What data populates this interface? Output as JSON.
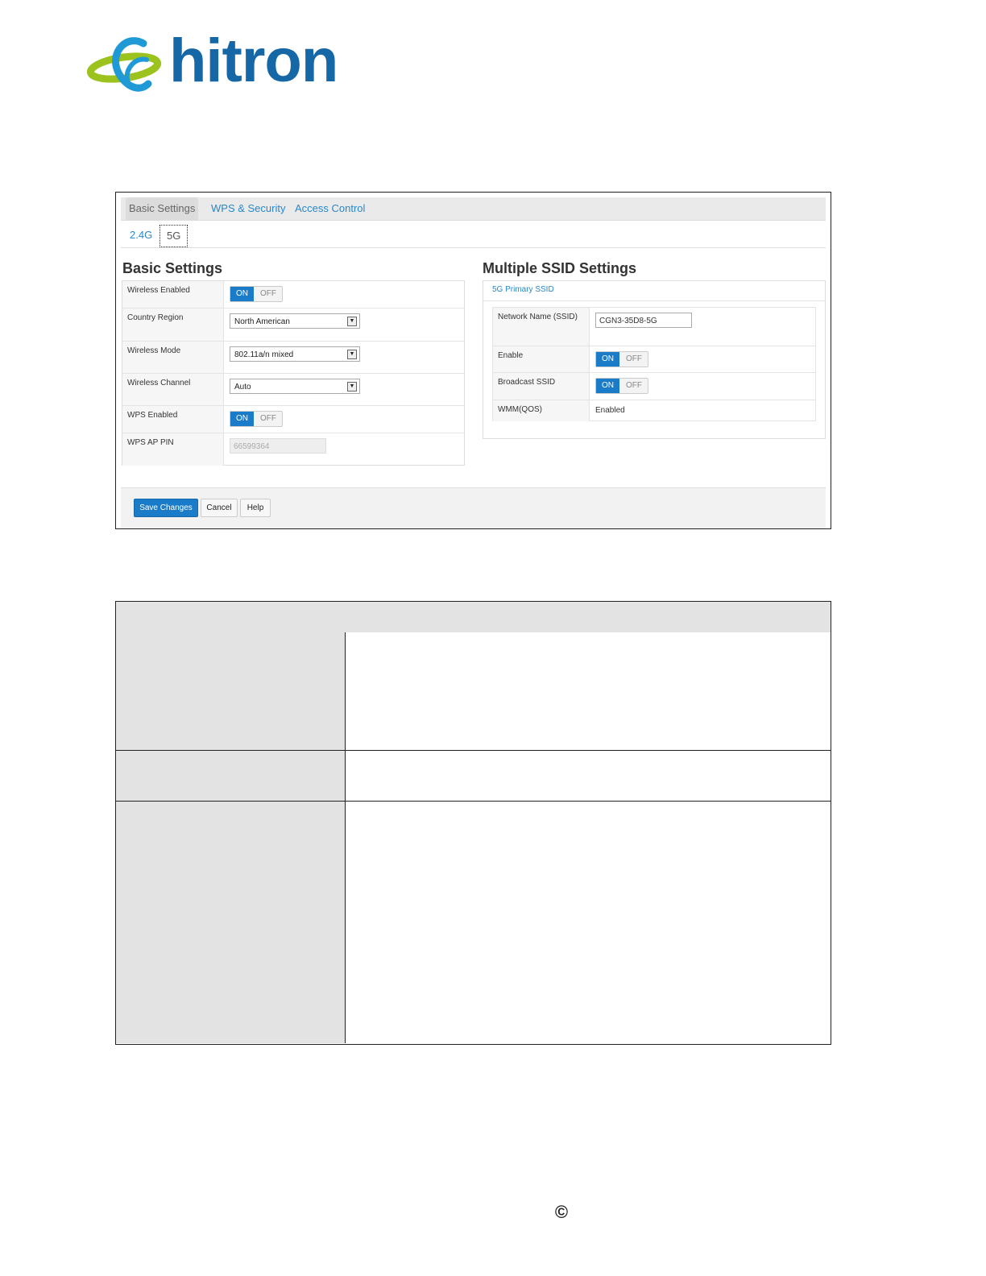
{
  "brand": {
    "name": "hitron",
    "primary_color": "#1667a5",
    "accent_color": "#9cc31d"
  },
  "tabs": [
    "Basic Settings",
    "WPS & Security",
    "Access Control"
  ],
  "active_tab": "Basic Settings",
  "band_tabs": [
    "2.4G",
    "5G"
  ],
  "active_band": "5G",
  "basic_settings": {
    "title": "Basic Settings",
    "wireless_enabled": {
      "label": "Wireless Enabled",
      "on": "ON",
      "off": "OFF"
    },
    "country_region": {
      "label": "Country Region",
      "value": "North American"
    },
    "wireless_mode": {
      "label": "Wireless Mode",
      "value": "802.11a/n mixed"
    },
    "wireless_channel": {
      "label": "Wireless Channel",
      "value": "Auto"
    },
    "wps_enabled": {
      "label": "WPS Enabled",
      "on": "ON",
      "off": "OFF"
    },
    "wps_ap_pin": {
      "label": "WPS AP PIN",
      "value": "66599364"
    }
  },
  "multiple_ssid": {
    "title": "Multiple SSID Settings",
    "subheader": "5G Primary SSID",
    "network_name": {
      "label": "Network Name (SSID)",
      "value": "CGN3-35D8-5G"
    },
    "enable": {
      "label": "Enable",
      "on": "ON",
      "off": "OFF"
    },
    "broadcast_ssid": {
      "label": "Broadcast SSID",
      "on": "ON",
      "off": "OFF"
    },
    "wmm": {
      "label": "WMM(QOS)",
      "value": "Enabled"
    }
  },
  "buttons": {
    "save": "Save Changes",
    "cancel": "Cancel",
    "help": "Help"
  },
  "footer": {
    "copyright_symbol": "©"
  }
}
